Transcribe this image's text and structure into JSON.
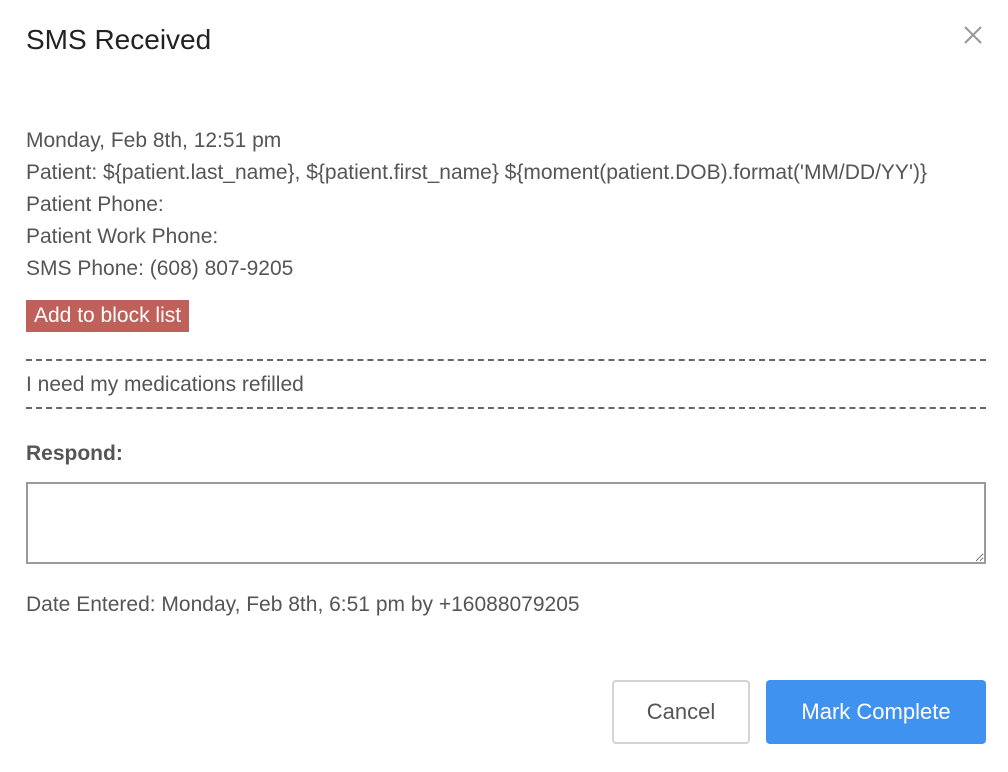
{
  "dialog": {
    "title": "SMS Received",
    "close_icon": "close-icon"
  },
  "info": {
    "received_date": "Monday, Feb 8th, 12:51 pm",
    "patient": "Patient: ${patient.last_name}, ${patient.first_name} ${moment(patient.DOB).format('MM/DD/YY')}",
    "patient_phone": "Patient Phone:",
    "patient_work_phone": "Patient Work Phone:",
    "sms_phone": "SMS Phone: (608) 807-9205"
  },
  "block_button": {
    "label": "Add to block list",
    "color": "#c0605a"
  },
  "message": {
    "text": "I need my medications refilled"
  },
  "respond": {
    "label": "Respond:",
    "value": ""
  },
  "date_entered": "Date Entered: Monday, Feb 8th, 6:51 pm by +16088079205",
  "footer": {
    "cancel_label": "Cancel",
    "complete_label": "Mark Complete",
    "accent_color": "#3f92f0"
  }
}
